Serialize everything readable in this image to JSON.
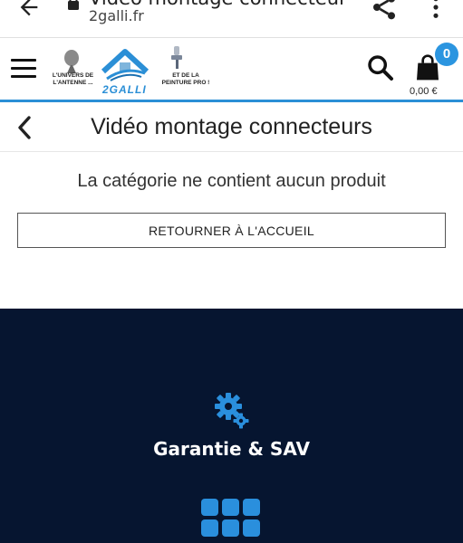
{
  "browser": {
    "page_title": "Vidéo montage connecteur",
    "url": "2galli.fr"
  },
  "header": {
    "logo_left_text": "L'UNIVERS DE L'ANTENNE ...",
    "logo_brand": "2GALLI",
    "logo_right_text": "ET DE LA PEINTURE PRO !",
    "cart_count": "0",
    "cart_total": "0,00 €"
  },
  "page": {
    "title": "Vidéo montage connecteurs",
    "empty_message": "La catégorie ne contient aucun produit",
    "home_button_label": "RETOURNER À L'ACCUEIL"
  },
  "footer": {
    "guarantee_label": "Garantie & SAV"
  },
  "colors": {
    "accent": "#2b8fd6",
    "footer_bg": "#061530"
  }
}
